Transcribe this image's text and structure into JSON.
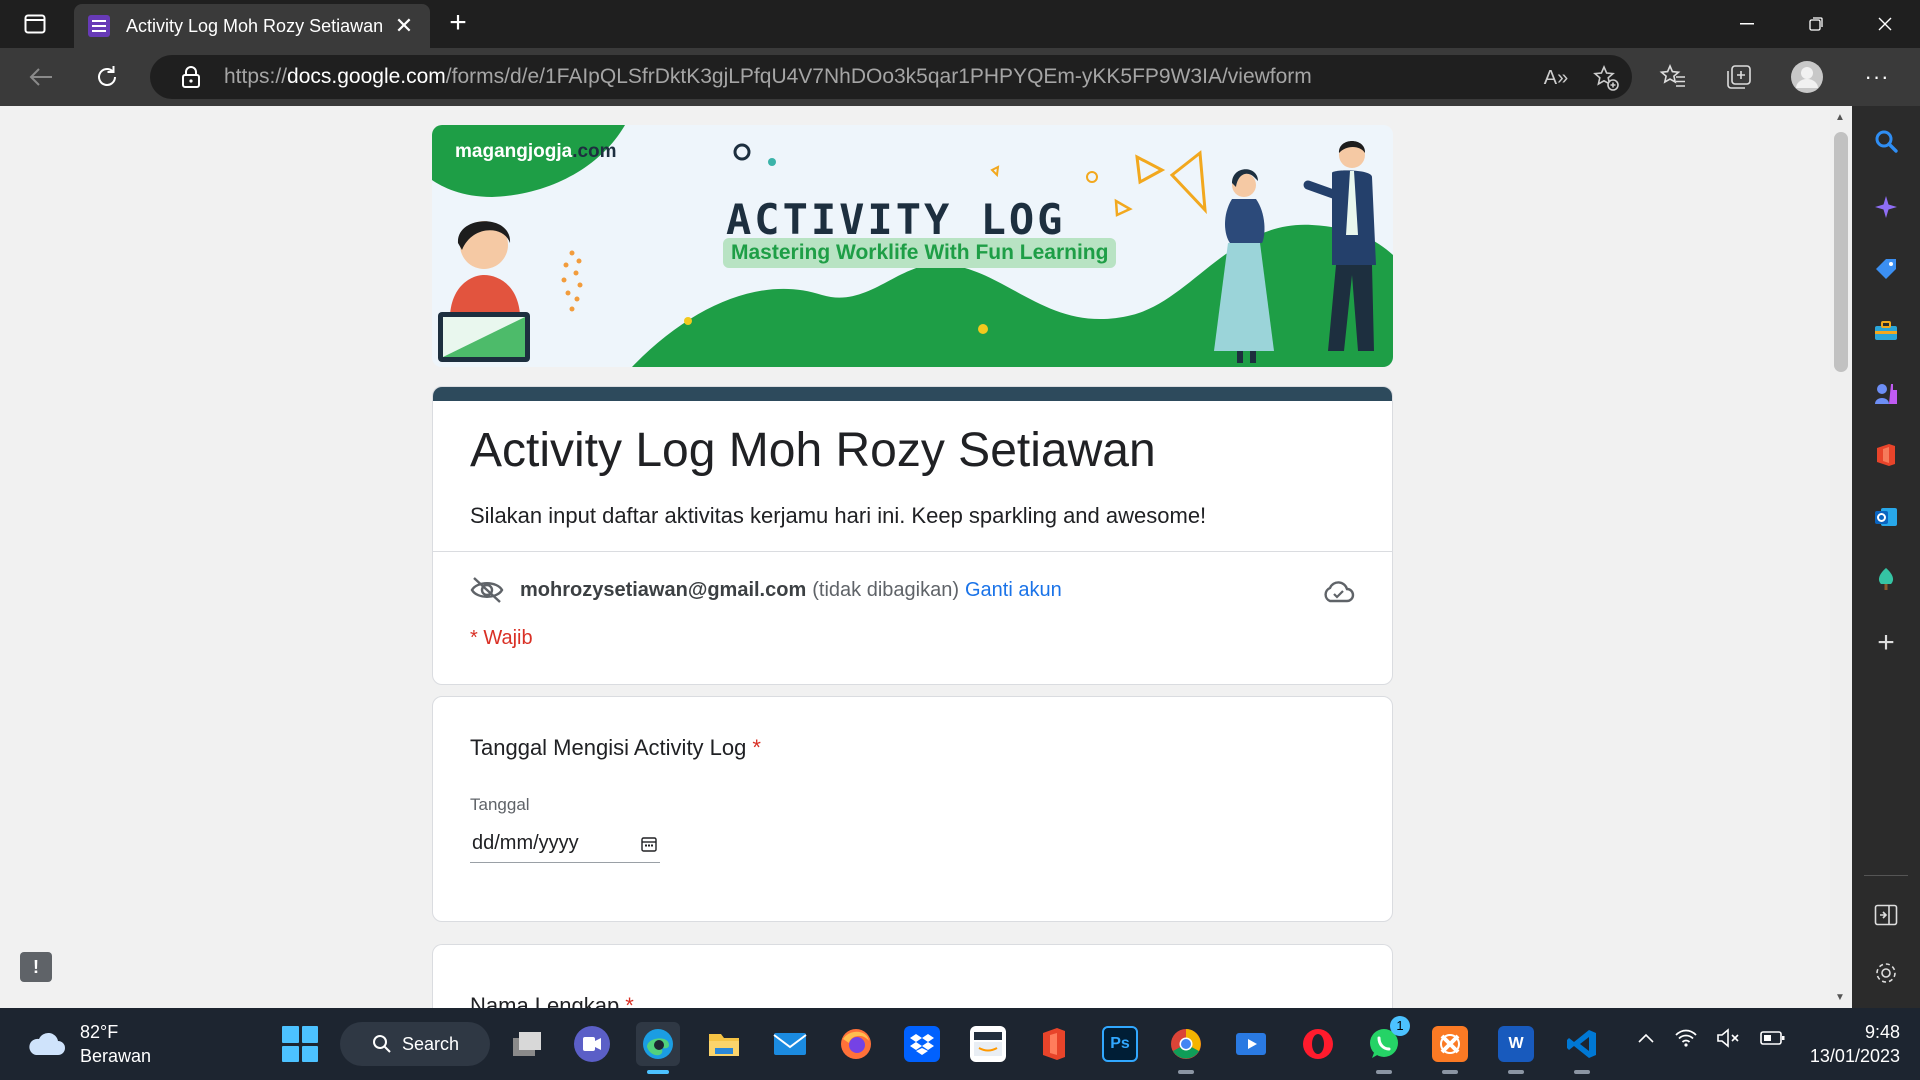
{
  "browser": {
    "tab_title": "Activity Log Moh Rozy Setiawan",
    "url_prefix": "https://",
    "url_domain": "docs.google.com",
    "url_path": "/forms/d/e/1FAIpQLSfrDktK3gjLPfqU4V7NhDOo3k5qar1PHPYQEm-yKK5FP9W3IA/viewform",
    "read_aloud_label": "A»"
  },
  "banner": {
    "site": "magangjogja",
    "site_tld": ".com",
    "headline": "ACTIVITY LOG",
    "tagline": "Mastering Worklife With Fun Learning"
  },
  "form": {
    "title": "Activity Log Moh Rozy Setiawan",
    "description": "Silakan input daftar aktivitas kerjamu hari ini. Keep sparkling and awesome!",
    "account_email": "mohrozysetiawan@gmail.com",
    "account_note": "(tidak dibagikan)",
    "switch_account": "Ganti akun",
    "required_note": "* Wajib",
    "questions": [
      {
        "title": "Tanggal Mengisi Activity Log",
        "required_mark": "*",
        "sublabel": "Tanggal",
        "placeholder": "dd/mm/yyyy"
      },
      {
        "title": "Nama Lengkap",
        "required_mark": "*"
      }
    ]
  },
  "feedback_label": "!",
  "taskbar": {
    "weather_temp": "82°F",
    "weather_desc": "Berawan",
    "search_label": "Search",
    "whatsapp_badge": "1",
    "time": "9:48",
    "date": "13/01/2023"
  },
  "colors": {
    "form_accent": "#2d4a5c",
    "link": "#1a73e8",
    "required": "#d93025",
    "banner_green": "#1e9e46",
    "edge_accent": "#4cc2ff"
  }
}
